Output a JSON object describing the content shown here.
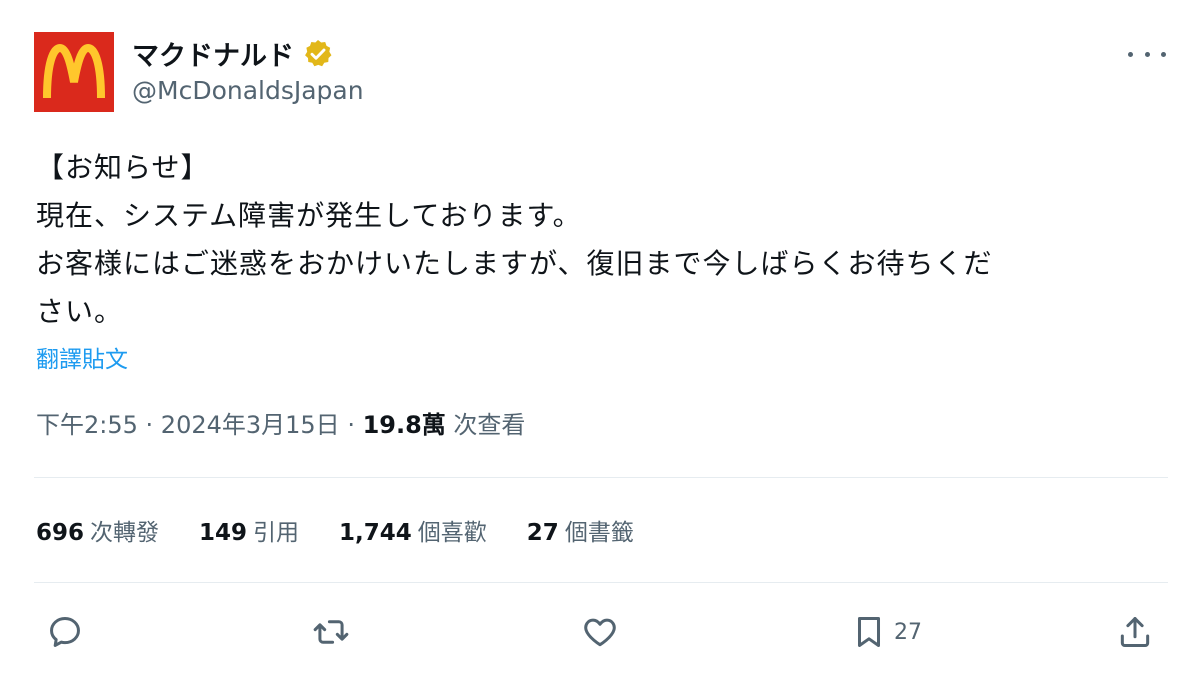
{
  "account": {
    "name": "マクドナルド",
    "handle": "@McDonaldsJapan",
    "logo_color": "#da291c",
    "logo_arch_color": "#ffc72c",
    "verified_color": "#e2b719"
  },
  "tweet": {
    "lines": [
      "【お知らせ】",
      "現在、システム障害が発生しております。",
      "お客様にはご迷惑をおかけいたしますが、復旧まで今しばらくお待ちくだ",
      "さい。"
    ],
    "translate_label": "翻譯貼文"
  },
  "meta": {
    "time": "下午2:55",
    "sep1": " · ",
    "date": "2024年3月15日",
    "sep2": " · ",
    "views": "19.8萬",
    "views_label": " 次查看"
  },
  "stats": [
    {
      "count": "696",
      "label": "次轉發"
    },
    {
      "count": "149",
      "label": "引用"
    },
    {
      "count": "1,744",
      "label": "個喜歡"
    },
    {
      "count": "27",
      "label": "個書籤"
    }
  ],
  "actions": {
    "reply_icon": "reply-icon",
    "retweet_icon": "retweet-icon",
    "like_icon": "heart-icon",
    "bookmark_icon": "bookmark-icon",
    "bookmark_count": "27",
    "share_icon": "share-icon"
  }
}
